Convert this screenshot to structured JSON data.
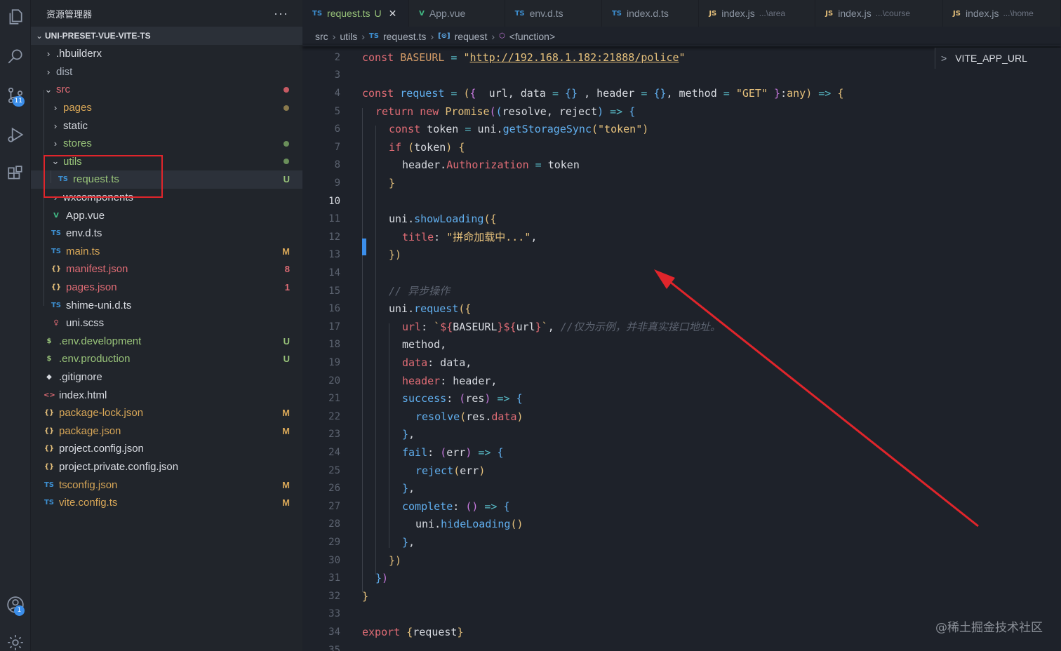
{
  "activity": {
    "icons": [
      "files-icon",
      "search-icon",
      "source-control-icon",
      "run-debug-icon",
      "extensions-icon",
      "account-icon",
      "settings-gear-icon"
    ],
    "source_control_badge": "11",
    "account_badge": "1"
  },
  "sidebar": {
    "title": "资源管理器",
    "more": "···",
    "project": "UNI-PRESET-VUE-VITE-TS",
    "items": [
      {
        "label": ".hbuilderx",
        "kind": "folder",
        "open": false,
        "depth": 1,
        "color": "default",
        "icon": "",
        "status": "",
        "dot": ""
      },
      {
        "label": "dist",
        "kind": "folder",
        "open": false,
        "depth": 1,
        "color": "muted",
        "icon": "",
        "status": "",
        "dot": ""
      },
      {
        "label": "src",
        "kind": "folder",
        "open": true,
        "depth": 1,
        "color": "red",
        "icon": "",
        "status": "",
        "dot": "#c75a63"
      },
      {
        "label": "pages",
        "kind": "folder",
        "open": false,
        "depth": 2,
        "color": "yellow",
        "icon": "",
        "status": "",
        "dot": "#8a7a4d"
      },
      {
        "label": "static",
        "kind": "folder",
        "open": false,
        "depth": 2,
        "color": "default",
        "icon": "",
        "status": "",
        "dot": ""
      },
      {
        "label": "stores",
        "kind": "folder",
        "open": false,
        "depth": 2,
        "color": "green",
        "icon": "",
        "status": "",
        "dot": "#6a8f5a"
      },
      {
        "label": "utils",
        "kind": "folder",
        "open": true,
        "depth": 2,
        "color": "green",
        "icon": "",
        "status": "",
        "dot": "#6a8f5a"
      },
      {
        "label": "request.ts",
        "kind": "file",
        "depth": 3,
        "color": "green",
        "icon": "TS",
        "icon_class": "ts-ico",
        "status": "U",
        "dot": "",
        "selected": true
      },
      {
        "label": "wxcomponents",
        "kind": "folder",
        "open": false,
        "depth": 2,
        "color": "default",
        "icon": "",
        "status": "",
        "dot": ""
      },
      {
        "label": "App.vue",
        "kind": "file",
        "depth": 2,
        "color": "default",
        "icon": "V",
        "icon_class": "vue-ico",
        "status": "",
        "dot": ""
      },
      {
        "label": "env.d.ts",
        "kind": "file",
        "depth": 2,
        "color": "default",
        "icon": "TS",
        "icon_class": "ts-ico",
        "status": "",
        "dot": ""
      },
      {
        "label": "main.ts",
        "kind": "file",
        "depth": 2,
        "color": "yellow",
        "icon": "TS",
        "icon_class": "ts-ico",
        "status": "M",
        "dot": ""
      },
      {
        "label": "manifest.json",
        "kind": "file",
        "depth": 2,
        "color": "red",
        "icon": "{}",
        "icon_class": "json-ico",
        "status": "8",
        "dot": ""
      },
      {
        "label": "pages.json",
        "kind": "file",
        "depth": 2,
        "color": "red",
        "icon": "{}",
        "icon_class": "json-ico",
        "status": "1",
        "dot": ""
      },
      {
        "label": "shime-uni.d.ts",
        "kind": "file",
        "depth": 2,
        "color": "default",
        "icon": "TS",
        "icon_class": "ts-ico",
        "status": "",
        "dot": ""
      },
      {
        "label": "uni.scss",
        "kind": "file",
        "depth": 2,
        "color": "default",
        "icon": "♀",
        "icon_class": "c-red",
        "status": "",
        "dot": ""
      },
      {
        "label": ".env.development",
        "kind": "file",
        "depth": 1,
        "color": "green",
        "icon": "$",
        "icon_class": "env-ico",
        "status": "U",
        "dot": ""
      },
      {
        "label": ".env.production",
        "kind": "file",
        "depth": 1,
        "color": "green",
        "icon": "$",
        "icon_class": "env-ico",
        "status": "U",
        "dot": ""
      },
      {
        "label": ".gitignore",
        "kind": "file",
        "depth": 1,
        "color": "default",
        "icon": "◆",
        "icon_class": "c-default",
        "status": "",
        "dot": ""
      },
      {
        "label": "index.html",
        "kind": "file",
        "depth": 1,
        "color": "default",
        "icon": "<>",
        "icon_class": "c-red",
        "status": "",
        "dot": ""
      },
      {
        "label": "package-lock.json",
        "kind": "file",
        "depth": 1,
        "color": "yellow",
        "icon": "{}",
        "icon_class": "json-ico",
        "status": "M",
        "dot": ""
      },
      {
        "label": "package.json",
        "kind": "file",
        "depth": 1,
        "color": "yellow",
        "icon": "{}",
        "icon_class": "json-ico",
        "status": "M",
        "dot": ""
      },
      {
        "label": "project.config.json",
        "kind": "file",
        "depth": 1,
        "color": "default",
        "icon": "{}",
        "icon_class": "json-ico",
        "status": "",
        "dot": ""
      },
      {
        "label": "project.private.config.json",
        "kind": "file",
        "depth": 1,
        "color": "default",
        "icon": "{}",
        "icon_class": "json-ico",
        "status": "",
        "dot": ""
      },
      {
        "label": "tsconfig.json",
        "kind": "file",
        "depth": 1,
        "color": "yellow",
        "icon": "TS",
        "icon_class": "ts-ico",
        "status": "M",
        "dot": ""
      },
      {
        "label": "vite.config.ts",
        "kind": "file",
        "depth": 1,
        "color": "yellow",
        "icon": "TS",
        "icon_class": "ts-ico",
        "status": "M",
        "dot": ""
      }
    ]
  },
  "tabs": [
    {
      "icon": "TS",
      "icon_color": "#3d8fd1",
      "label": "request.ts",
      "hint": "",
      "mod": "U",
      "close": "✕",
      "active": true
    },
    {
      "icon": "V",
      "icon_color": "#41b883",
      "label": "App.vue",
      "hint": "",
      "mod": "",
      "close": "",
      "active": false
    },
    {
      "icon": "TS",
      "icon_color": "#3d8fd1",
      "label": "env.d.ts",
      "hint": "",
      "mod": "",
      "close": "",
      "active": false
    },
    {
      "icon": "TS",
      "icon_color": "#3d8fd1",
      "label": "index.d.ts",
      "hint": "",
      "mod": "",
      "close": "",
      "active": false
    },
    {
      "icon": "JS",
      "icon_color": "#e5c07b",
      "label": "index.js",
      "hint": "...\\area",
      "mod": "",
      "close": "",
      "active": false
    },
    {
      "icon": "JS",
      "icon_color": "#e5c07b",
      "label": "index.js",
      "hint": "...\\course",
      "mod": "",
      "close": "",
      "active": false
    },
    {
      "icon": "JS",
      "icon_color": "#e5c07b",
      "label": "index.js",
      "hint": "...\\home",
      "mod": "",
      "close": "",
      "active": false
    }
  ],
  "breadcrumb": {
    "src": "src",
    "utils": "utils",
    "file_icon": "TS",
    "file": "request.ts",
    "var_icon": "[⊙]",
    "symbol": "request",
    "fn_icon": "⬡",
    "fn": "<function>"
  },
  "outline": {
    "label": "VITE_APP_URL",
    "chev": ">"
  },
  "editor": {
    "current_line": 10,
    "lines": [
      {
        "n": 2,
        "indent": 0,
        "html": [
          [
            "kw",
            "const "
          ],
          [
            "cn",
            "BASEURL"
          ],
          [
            "op",
            " = "
          ],
          [
            "st",
            "\""
          ],
          [
            "url",
            "http://192.168.1.182:21888/police"
          ],
          [
            "st",
            "\""
          ]
        ]
      },
      {
        "n": 3,
        "indent": 0,
        "html": []
      },
      {
        "n": 4,
        "indent": 0,
        "html": [
          [
            "kw",
            "const "
          ],
          [
            "fn",
            "request"
          ],
          [
            "op",
            " = "
          ],
          [
            "b1",
            "("
          ],
          [
            "b2",
            "{"
          ],
          [
            "",
            "  url, data "
          ],
          [
            "op",
            "= "
          ],
          [
            "b3",
            "{}"
          ],
          [
            "",
            " , header "
          ],
          [
            "op",
            "= "
          ],
          [
            "b3",
            "{}"
          ],
          [
            "",
            ", method "
          ],
          [
            "op",
            "= "
          ],
          [
            "st",
            "\"GET\" "
          ],
          [
            "b2",
            "}"
          ],
          [
            "",
            ":"
          ],
          [
            "ty",
            "any"
          ],
          [
            "b1",
            ")"
          ],
          [
            "op",
            " => "
          ],
          [
            "b1",
            "{"
          ]
        ]
      },
      {
        "n": 5,
        "indent": 1,
        "html": [
          [
            "kw",
            "return "
          ],
          [
            "kw",
            "new "
          ],
          [
            "ty",
            "Promise"
          ],
          [
            "b2",
            "("
          ],
          [
            "b3",
            "("
          ],
          [
            "",
            "resolve, reject"
          ],
          [
            "b3",
            ")"
          ],
          [
            "op",
            " => "
          ],
          [
            "b3",
            "{"
          ]
        ]
      },
      {
        "n": 6,
        "indent": 2,
        "html": [
          [
            "kw",
            "const "
          ],
          [
            "",
            "token "
          ],
          [
            "op",
            "= "
          ],
          [
            "",
            "uni."
          ],
          [
            "fn",
            "getStorageSync"
          ],
          [
            "b1",
            "("
          ],
          [
            "st",
            "\"token\""
          ],
          [
            "b1",
            ")"
          ]
        ]
      },
      {
        "n": 7,
        "indent": 2,
        "html": [
          [
            "kw",
            "if "
          ],
          [
            "b1",
            "("
          ],
          [
            "",
            "token"
          ],
          [
            "b1",
            ") {"
          ]
        ]
      },
      {
        "n": 8,
        "indent": 3,
        "html": [
          [
            "",
            "header."
          ],
          [
            "pr",
            "Authorization"
          ],
          [
            "op",
            " = "
          ],
          [
            "",
            "token"
          ]
        ]
      },
      {
        "n": 9,
        "indent": 2,
        "html": [
          [
            "b1",
            "}"
          ]
        ]
      },
      {
        "n": 10,
        "indent": 0,
        "html": []
      },
      {
        "n": 11,
        "indent": 2,
        "html": [
          [
            "",
            "uni."
          ],
          [
            "fn",
            "showLoading"
          ],
          [
            "b1",
            "({"
          ]
        ]
      },
      {
        "n": 12,
        "indent": 3,
        "html": [
          [
            "pr",
            "title"
          ],
          [
            "",
            ": "
          ],
          [
            "st",
            "\"拼命加载中...\""
          ],
          [
            "",
            ","
          ]
        ]
      },
      {
        "n": 13,
        "indent": 2,
        "html": [
          [
            "b1",
            "})"
          ]
        ]
      },
      {
        "n": 14,
        "indent": 0,
        "html": []
      },
      {
        "n": 15,
        "indent": 2,
        "html": [
          [
            "cm",
            "// 异步操作"
          ]
        ]
      },
      {
        "n": 16,
        "indent": 2,
        "html": [
          [
            "",
            "uni."
          ],
          [
            "fn",
            "request"
          ],
          [
            "b1",
            "({"
          ]
        ]
      },
      {
        "n": 17,
        "indent": 3,
        "html": [
          [
            "pr",
            "url"
          ],
          [
            "",
            ": "
          ],
          [
            "st",
            "`"
          ],
          [
            "kw",
            "${"
          ],
          [
            "",
            "BASEURL"
          ],
          [
            "kw",
            "}${"
          ],
          [
            "",
            "url"
          ],
          [
            "kw",
            "}"
          ],
          [
            "st",
            "`"
          ],
          [
            "",
            ", "
          ],
          [
            "cm",
            "//仅为示例，并非真实接口地址。"
          ]
        ]
      },
      {
        "n": 18,
        "indent": 3,
        "html": [
          [
            "",
            "method,"
          ]
        ]
      },
      {
        "n": 19,
        "indent": 3,
        "html": [
          [
            "pr",
            "data"
          ],
          [
            "",
            ": data,"
          ]
        ]
      },
      {
        "n": 20,
        "indent": 3,
        "html": [
          [
            "pr",
            "header"
          ],
          [
            "",
            ": header,"
          ]
        ]
      },
      {
        "n": 21,
        "indent": 3,
        "html": [
          [
            "fn",
            "success"
          ],
          [
            "",
            ": "
          ],
          [
            "b2",
            "("
          ],
          [
            "",
            "res"
          ],
          [
            "b2",
            ")"
          ],
          [
            "op",
            " => "
          ],
          [
            "b3",
            "{"
          ]
        ]
      },
      {
        "n": 22,
        "indent": 4,
        "html": [
          [
            "fn",
            "resolve"
          ],
          [
            "b1",
            "("
          ],
          [
            "",
            "res."
          ],
          [
            "pr",
            "data"
          ],
          [
            "b1",
            ")"
          ]
        ]
      },
      {
        "n": 23,
        "indent": 3,
        "html": [
          [
            "b3",
            "}"
          ],
          [
            "",
            ","
          ]
        ]
      },
      {
        "n": 24,
        "indent": 3,
        "html": [
          [
            "fn",
            "fail"
          ],
          [
            "",
            ": "
          ],
          [
            "b2",
            "("
          ],
          [
            "",
            "err"
          ],
          [
            "b2",
            ")"
          ],
          [
            "op",
            " => "
          ],
          [
            "b3",
            "{"
          ]
        ]
      },
      {
        "n": 25,
        "indent": 4,
        "html": [
          [
            "fn",
            "reject"
          ],
          [
            "b1",
            "("
          ],
          [
            "",
            "err"
          ],
          [
            "b1",
            ")"
          ]
        ]
      },
      {
        "n": 26,
        "indent": 3,
        "html": [
          [
            "b3",
            "}"
          ],
          [
            "",
            ","
          ]
        ]
      },
      {
        "n": 27,
        "indent": 3,
        "html": [
          [
            "fn",
            "complete"
          ],
          [
            "",
            ": "
          ],
          [
            "b2",
            "()"
          ],
          [
            "op",
            " => "
          ],
          [
            "b3",
            "{"
          ]
        ]
      },
      {
        "n": 28,
        "indent": 4,
        "html": [
          [
            "",
            "uni."
          ],
          [
            "fn",
            "hideLoading"
          ],
          [
            "b1",
            "()"
          ]
        ]
      },
      {
        "n": 29,
        "indent": 3,
        "html": [
          [
            "b3",
            "}"
          ],
          [
            "",
            ","
          ]
        ]
      },
      {
        "n": 30,
        "indent": 2,
        "html": [
          [
            "b1",
            "})"
          ]
        ]
      },
      {
        "n": 31,
        "indent": 1,
        "html": [
          [
            "b3",
            "}"
          ],
          [
            "b2",
            ")"
          ]
        ]
      },
      {
        "n": 32,
        "indent": 0,
        "html": [
          [
            "b1",
            "}"
          ]
        ]
      },
      {
        "n": 33,
        "indent": 0,
        "html": []
      },
      {
        "n": 34,
        "indent": 0,
        "html": [
          [
            "kw",
            "export "
          ],
          [
            "b1",
            "{"
          ],
          [
            "",
            "request"
          ],
          [
            "b1",
            "}"
          ]
        ]
      },
      {
        "n": 35,
        "indent": 0,
        "html": []
      }
    ]
  },
  "watermark": "@稀土掘金技术社区",
  "colors": {
    "red_annotation": "#e0252b",
    "accent": "#3b8eea"
  }
}
